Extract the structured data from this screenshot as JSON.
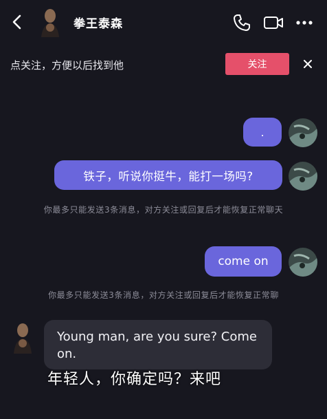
{
  "header": {
    "title": "拳王泰森",
    "back_icon": "chevron-left-icon",
    "icons": [
      "phone-icon",
      "video-icon",
      "more-icon"
    ]
  },
  "follow_bar": {
    "text": "点关注，方便以后找到他",
    "button_label": "关注",
    "button_color": "#e5506a"
  },
  "messages": [
    {
      "from": "me",
      "text": "."
    },
    {
      "from": "me",
      "text": "铁子，听说你挺牛，能打一场吗?"
    },
    {
      "from": "me",
      "text": "come on"
    }
  ],
  "system_notes": [
    "你最多只能发送3条消息，对方关注或回复后才能恢复正常聊天",
    "你最多只能发送3条消息，对方关注或回复后才能恢复正常聊"
  ],
  "incoming": {
    "from": "them",
    "text": "Young man, are you sure? Come on."
  },
  "subtitle": "年轻人，你确定吗？来吧",
  "colors": {
    "bubble_me": "#6a66dc",
    "bubble_them": "#2d2d37",
    "background": "#17171f"
  }
}
